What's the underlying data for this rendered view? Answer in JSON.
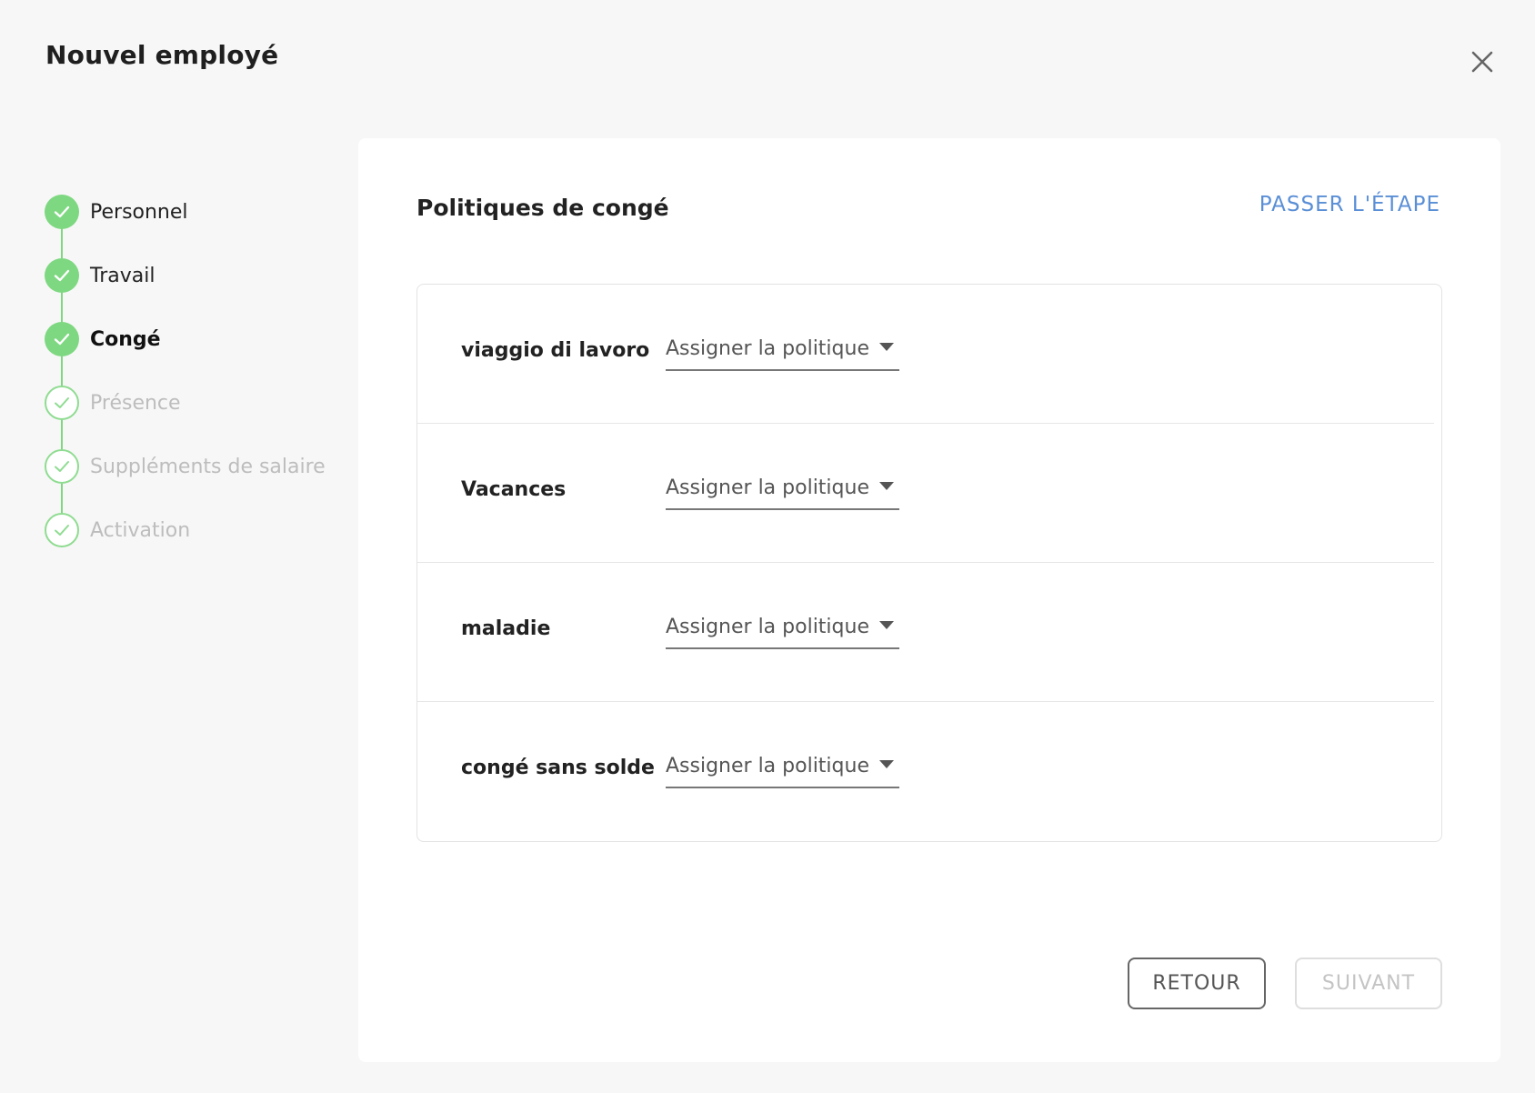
{
  "dialog": {
    "title": "Nouvel employé",
    "close_icon": "close-icon"
  },
  "stepper": {
    "steps": [
      {
        "label": "Personnel",
        "status": "done"
      },
      {
        "label": "Travail",
        "status": "done"
      },
      {
        "label": "Congé",
        "status": "active"
      },
      {
        "label": "Présence",
        "status": "pending"
      },
      {
        "label": "Suppléments de salaire",
        "status": "pending"
      },
      {
        "label": "Activation",
        "status": "pending"
      }
    ]
  },
  "main": {
    "section_title": "Politiques de congé",
    "skip_label": "PASSER L'ÉTAPE",
    "policies": [
      {
        "name": "viaggio di lavoro",
        "select_placeholder": "Assigner la politique"
      },
      {
        "name": "Vacances",
        "select_placeholder": "Assigner la politique"
      },
      {
        "name": "maladie",
        "select_placeholder": "Assigner la politique"
      },
      {
        "name": "congé sans solde",
        "select_placeholder": "Assigner la politique"
      }
    ]
  },
  "actions": {
    "back_label": "RETOUR",
    "next_label": "SUIVANT",
    "next_disabled": true
  },
  "colors": {
    "step_done": "#7ed881",
    "link": "#5a8fd6",
    "pending_text": "#bdbdbd"
  }
}
